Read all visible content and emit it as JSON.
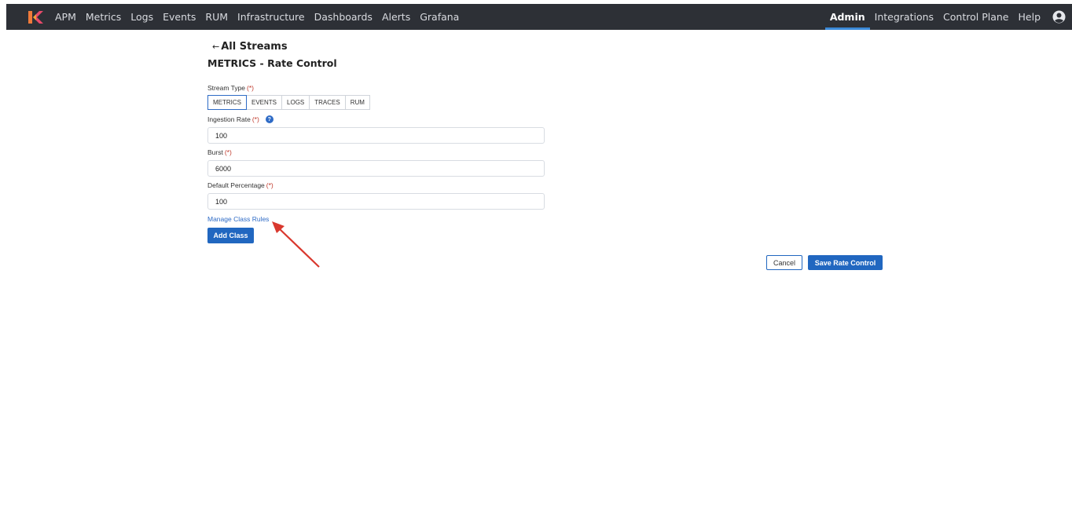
{
  "nav": {
    "left_items": [
      "APM",
      "Metrics",
      "Logs",
      "Events",
      "RUM",
      "Infrastructure",
      "Dashboards",
      "Alerts",
      "Grafana"
    ],
    "right_items": [
      "Admin",
      "Integrations",
      "Control Plane",
      "Help"
    ],
    "active": "Admin",
    "logo_icon": "k-logo-icon",
    "user_icon": "user-circle-icon"
  },
  "back_link": "All Streams",
  "page_title": "METRICS - Rate Control",
  "stream_type": {
    "label": "Stream Type",
    "required_mark": "(*)",
    "options": [
      "METRICS",
      "EVENTS",
      "LOGS",
      "TRACES",
      "RUM"
    ],
    "selected": "METRICS"
  },
  "ingestion_rate": {
    "label": "Ingestion Rate",
    "required_mark": "(*)",
    "value": "100",
    "help_icon": "question-circle-icon"
  },
  "burst": {
    "label": "Burst",
    "required_mark": "(*)",
    "value": "6000"
  },
  "default_percentage": {
    "label": "Default Percentage",
    "required_mark": "(*)",
    "value": "100"
  },
  "manage_class_rules": "Manage Class Rules",
  "add_class_label": "Add Class",
  "cancel_label": "Cancel",
  "save_label": "Save Rate Control",
  "colors": {
    "nav_bg": "#2d3036",
    "accent": "#2167c0",
    "required": "#c0392b",
    "annotation_arrow": "#d9382e"
  }
}
